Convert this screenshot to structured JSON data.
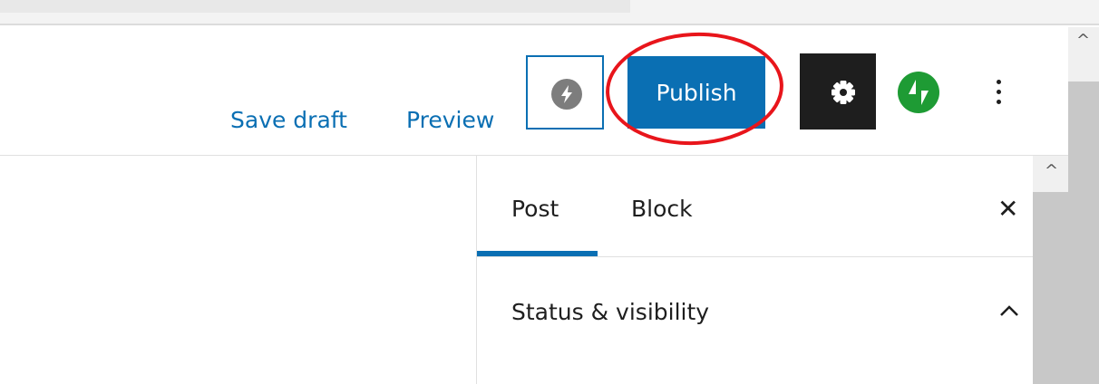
{
  "toolbar": {
    "save_draft_label": "Save draft",
    "preview_label": "Preview",
    "publish_label": "Publish",
    "jetpack_icon": "bolt-icon",
    "settings_icon": "gear-icon",
    "jetpack_green_icon": "jetpack-icon",
    "more_icon": "more-vertical-icon"
  },
  "sidebar": {
    "tabs": [
      {
        "label": "Post",
        "active": true
      },
      {
        "label": "Block",
        "active": false
      }
    ],
    "close_icon": "close-icon",
    "panel": {
      "title": "Status & visibility",
      "toggle_icon": "chevron-up-icon"
    }
  },
  "colors": {
    "accent": "#0a6fb3",
    "highlight": "#e8151b",
    "jetpack_green": "#1e9b34",
    "settings_bg": "#1e1e1e"
  }
}
